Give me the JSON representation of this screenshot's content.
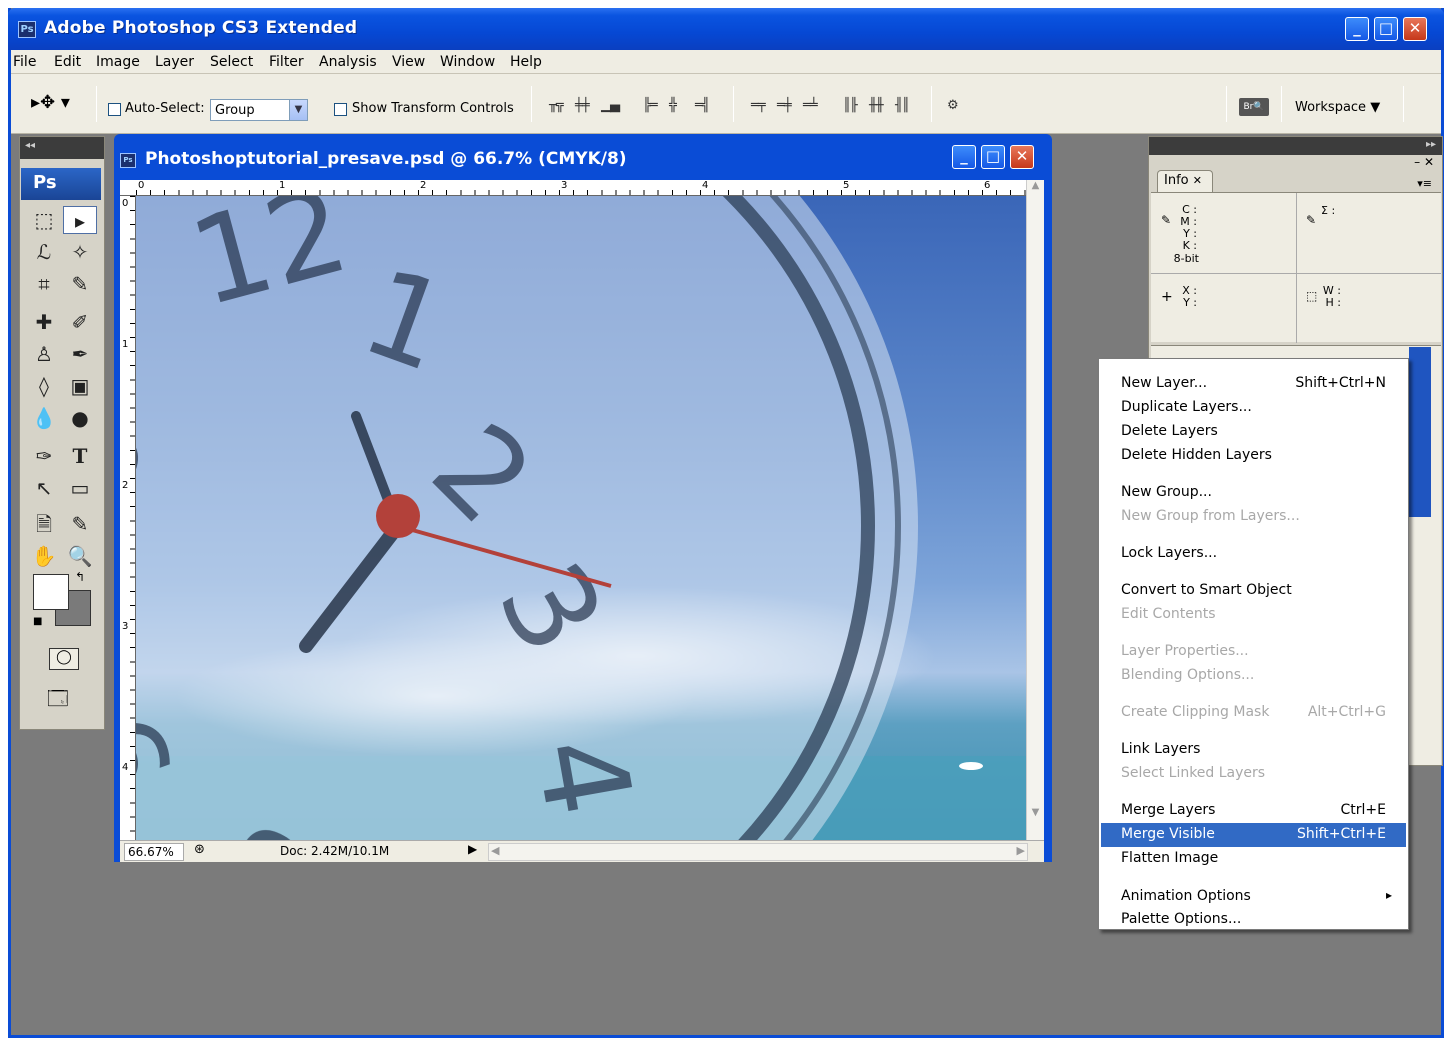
{
  "app": {
    "title": "Adobe Photoshop CS3 Extended",
    "icon_label": "Ps"
  },
  "menubar": [
    "File",
    "Edit",
    "Image",
    "Layer",
    "Select",
    "Filter",
    "Analysis",
    "View",
    "Window",
    "Help"
  ],
  "options": {
    "auto_select_label": "Auto-Select:",
    "auto_select_value": "Group",
    "show_transform_label": "Show Transform Controls",
    "workspace_label": "Workspace ▼"
  },
  "toolbox": {
    "logo": "Ps"
  },
  "document": {
    "title": "Photoshoptutorial_presave.psd @ 66.7% (CMYK/8)",
    "icon_label": "Ps",
    "ruler_h": [
      "0",
      "1",
      "2",
      "3",
      "4",
      "5",
      "6"
    ],
    "ruler_v": [
      "0",
      "1",
      "2",
      "3",
      "4"
    ],
    "zoom": "66.67%",
    "doc_info": "Doc: 2.42M/10.1M"
  },
  "info_panel": {
    "tab": "Info",
    "cmyk": "C :\nM :\nY :\nK :",
    "bit": "8-bit",
    "sigma": "Σ :",
    "xy": "X :\nY :",
    "wh": "W :\nH :"
  },
  "context_menu": [
    {
      "label": "New Layer...",
      "shortcut": "Shift+Ctrl+N",
      "enabled": true
    },
    {
      "label": "Duplicate Layers...",
      "shortcut": "",
      "enabled": true
    },
    {
      "label": "Delete Layers",
      "shortcut": "",
      "enabled": true
    },
    {
      "label": "Delete Hidden Layers",
      "shortcut": "",
      "enabled": true
    },
    {
      "label": "New Group...",
      "shortcut": "",
      "enabled": true
    },
    {
      "label": "New Group from Layers...",
      "shortcut": "",
      "enabled": false
    },
    {
      "label": "Lock Layers...",
      "shortcut": "",
      "enabled": true
    },
    {
      "label": "Convert to Smart Object",
      "shortcut": "",
      "enabled": true
    },
    {
      "label": "Edit Contents",
      "shortcut": "",
      "enabled": false
    },
    {
      "label": "Layer Properties...",
      "shortcut": "",
      "enabled": false
    },
    {
      "label": "Blending Options...",
      "shortcut": "",
      "enabled": false
    },
    {
      "label": "Create Clipping Mask",
      "shortcut": "Alt+Ctrl+G",
      "enabled": false
    },
    {
      "label": "Link Layers",
      "shortcut": "",
      "enabled": true
    },
    {
      "label": "Select Linked Layers",
      "shortcut": "",
      "enabled": false
    },
    {
      "label": "Merge Layers",
      "shortcut": "Ctrl+E",
      "enabled": true
    },
    {
      "label": "Merge Visible",
      "shortcut": "Shift+Ctrl+E",
      "enabled": true,
      "highlighted": true
    },
    {
      "label": "Flatten Image",
      "shortcut": "",
      "enabled": true
    },
    {
      "label": "Animation Options",
      "shortcut": "▸",
      "enabled": true
    },
    {
      "label": "Palette Options...",
      "shortcut": "",
      "enabled": true
    }
  ],
  "colors": {
    "titlebar": "#0a54e0",
    "menu_highlight": "#316ac5",
    "workspace_bg": "#7b7b7b",
    "chrome": "#efede3"
  }
}
